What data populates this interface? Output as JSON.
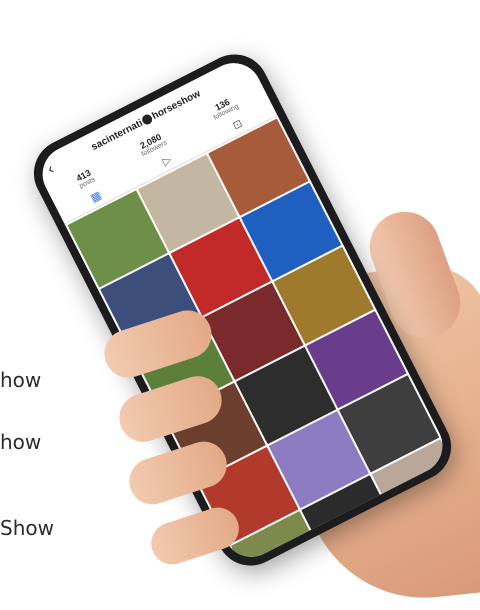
{
  "side_labels": [
    "how",
    "how",
    " Show"
  ],
  "profile": {
    "handle": "sacinternati",
    "handle_suffix": "horseshow",
    "posts": {
      "count": "413",
      "label": "posts"
    },
    "followers": {
      "count": "2,080",
      "label": "followers"
    },
    "following": {
      "count": "136",
      "label": "following"
    }
  },
  "icons": {
    "back": "back-arrow-icon",
    "grid": "grid-icon",
    "reels": "reels-icon",
    "tagged": "tagged-icon"
  },
  "colors": {
    "accent": "#3b7cd9",
    "tiles": [
      "#6e8f47",
      "#c3b7a1",
      "#a85b3a",
      "#3b4f7a",
      "#c22a2a",
      "#1f5fbf",
      "#5c7f3a",
      "#7a2a2a",
      "#a07a2c",
      "#6b3e2e",
      "#2d2d2d",
      "#6a3c8c",
      "#b23a2d",
      "#8e7cc2",
      "#3e3e3e",
      "#7d8a4c",
      "#2b2b2b",
      "#b9a89a"
    ]
  }
}
